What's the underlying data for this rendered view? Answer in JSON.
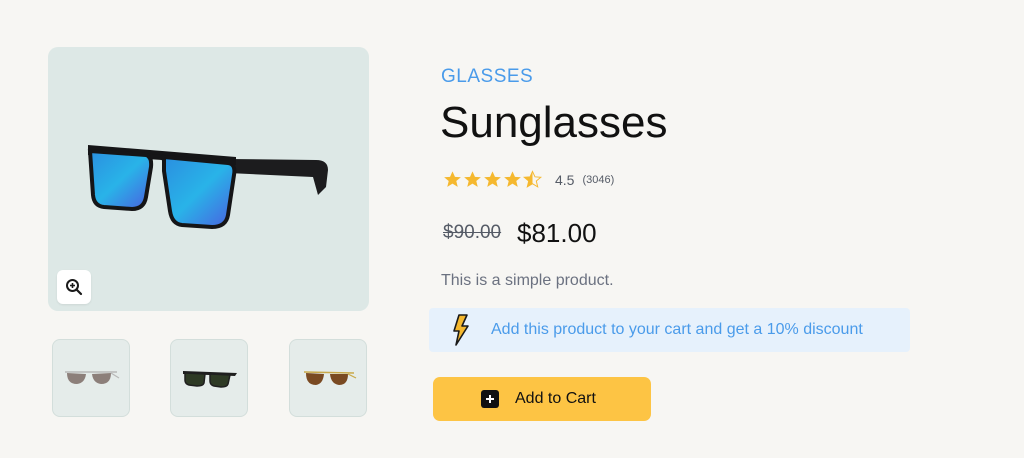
{
  "gallery": {
    "main_image_icon": "sunglasses-blue-mirror",
    "zoom_icon": "zoom-in-icon",
    "thumbnails": [
      {
        "icon": "sunglasses-aviator-gradient"
      },
      {
        "icon": "sunglasses-green-wayfarer"
      },
      {
        "icon": "sunglasses-brown-gold"
      }
    ]
  },
  "product": {
    "category": "GLASSES",
    "title": "Sunglasses",
    "rating": {
      "value": "4.5",
      "count": "(3046)",
      "stars_filled": 4.5,
      "stars_total": 5
    },
    "old_price": "$90.00",
    "price": "$81.00",
    "description": "This is a simple product.",
    "promo": {
      "icon": "lightning-bolt-icon",
      "text": "Add this product to your cart and get a 10% discount"
    },
    "add_to_cart_label": "Add to Cart"
  },
  "colors": {
    "accent": "#4a9bea",
    "star": "#f5b82e",
    "button": "#fdc444",
    "promo_bg": "#e6f1fc"
  }
}
